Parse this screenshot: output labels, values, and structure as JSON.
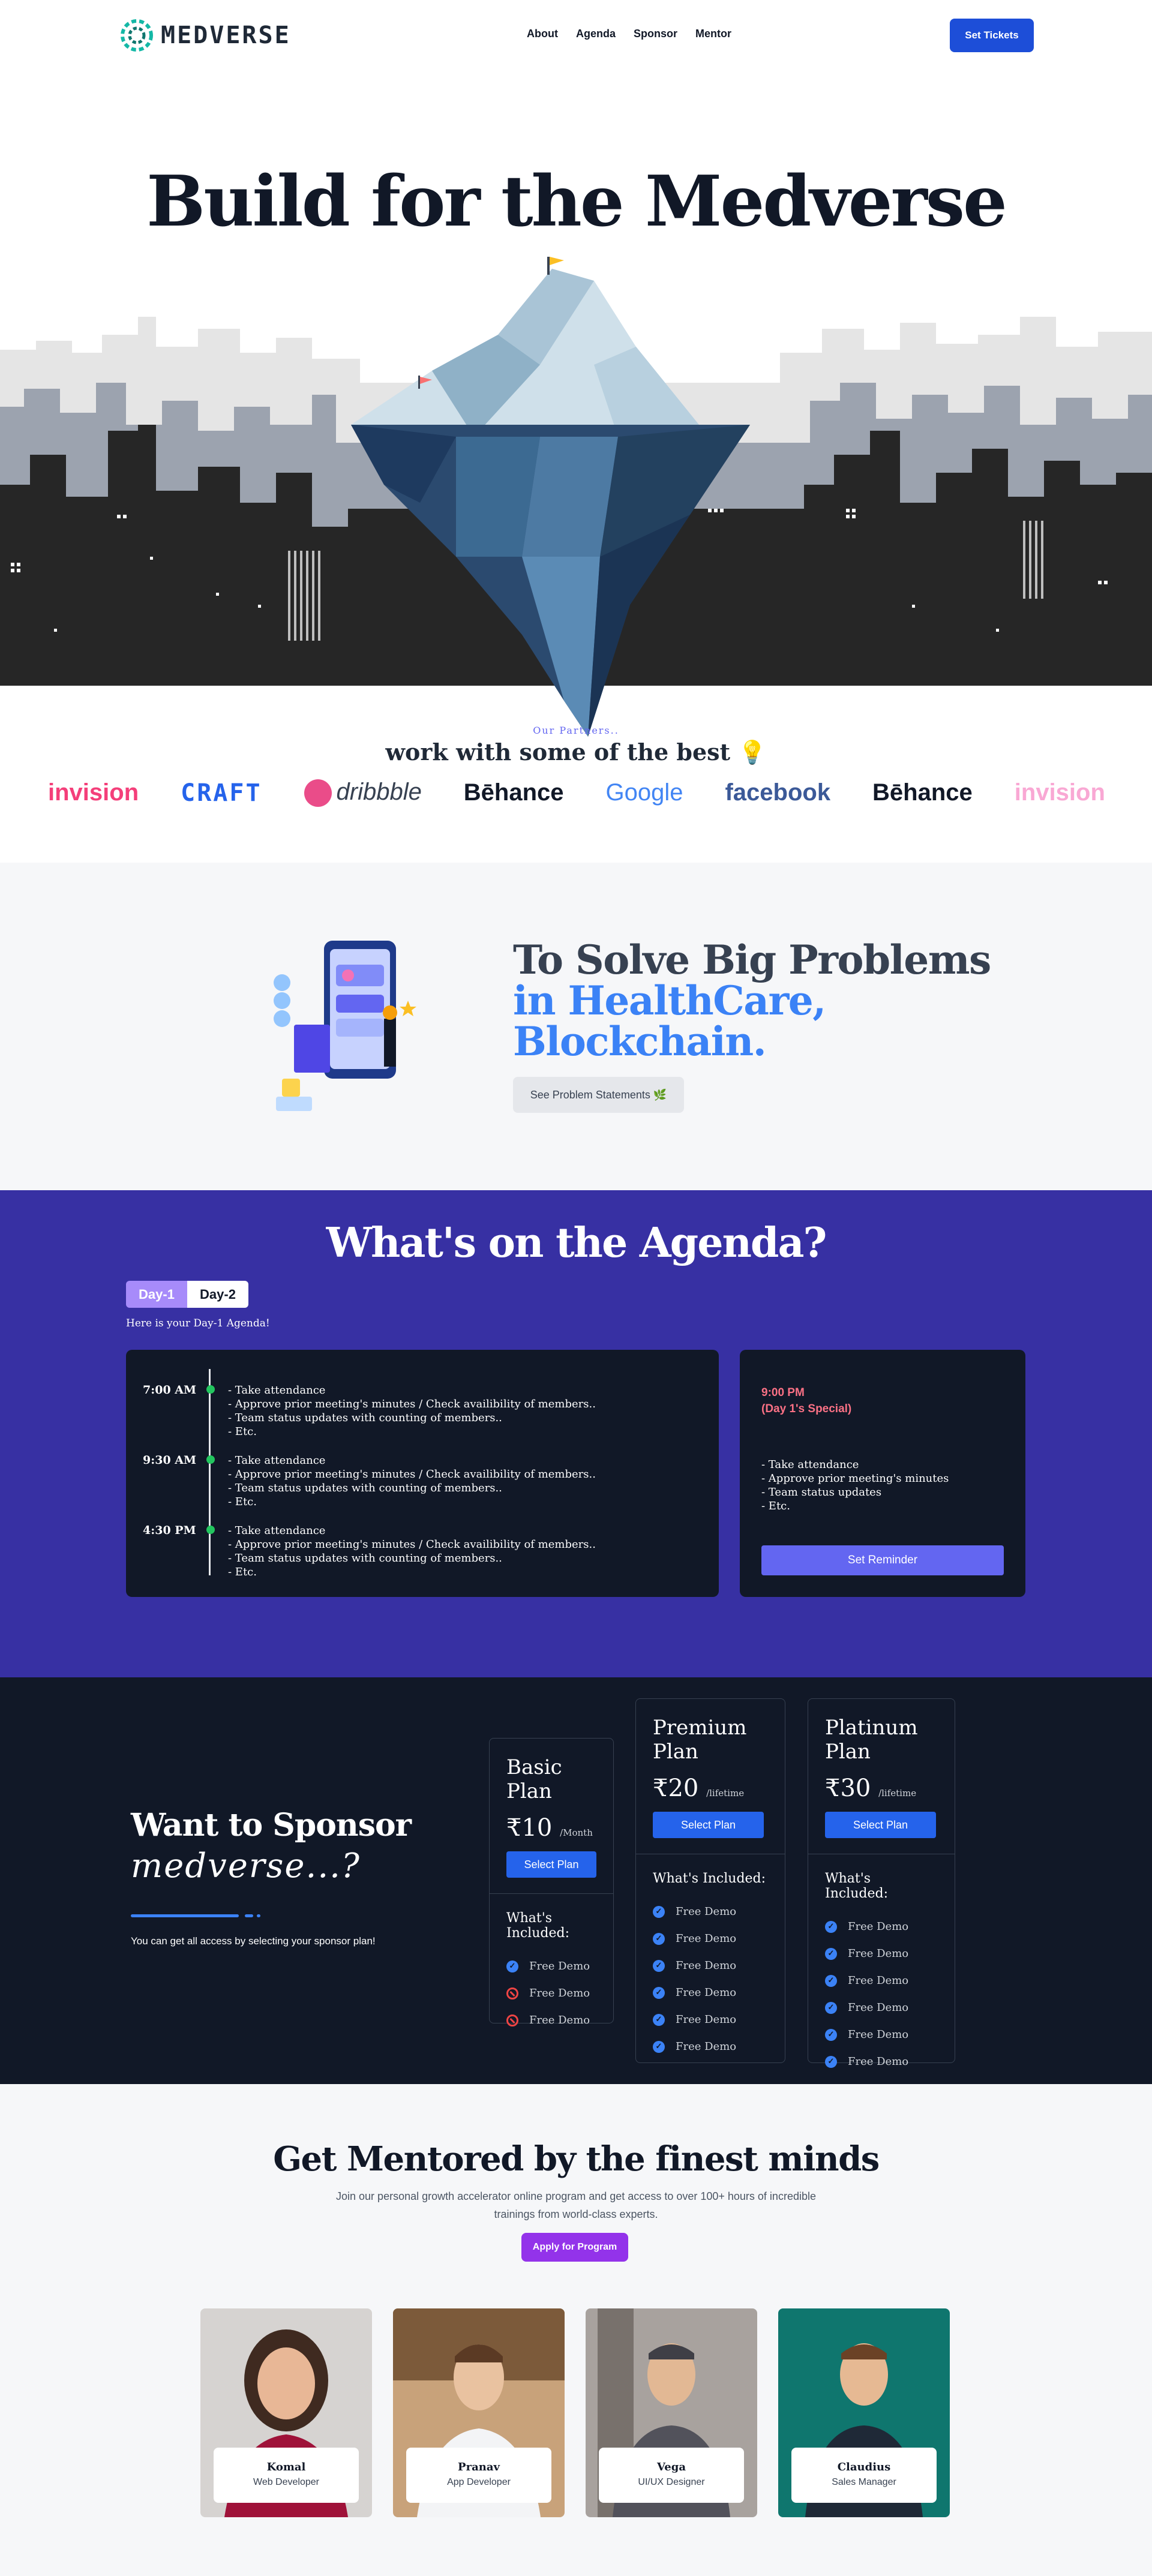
{
  "brand": {
    "name": "MEDVERSE"
  },
  "nav": {
    "links": [
      "About",
      "Agenda",
      "Sponsor",
      "Mentor"
    ],
    "cta": "Set Tickets"
  },
  "hero": {
    "title": "Build for the Medverse"
  },
  "partners": {
    "eyebrow": "Our Partners..",
    "title": "work with some of the best 💡",
    "logos": [
      "invision",
      "CRAFT",
      "dribbble",
      "Bēhance",
      "Google",
      "facebook",
      "Bēhance",
      "invision"
    ]
  },
  "problems": {
    "line1": "To Solve Big Problems",
    "line2": "in HealthCare,",
    "line3": "Blockchain.",
    "button": "See Problem Statements 🌿"
  },
  "agenda": {
    "title": "What's on the Agenda?",
    "tabs": [
      "Day-1",
      "Day-2"
    ],
    "subtitle": "Here is your Day-1 Agenda!",
    "slots": [
      {
        "time": "7:00 AM",
        "items": [
          "- Take attendance",
          "- Approve prior meeting's minutes / Check availibility of members..",
          "- Team status updates with counting of members..",
          "- Etc."
        ]
      },
      {
        "time": "9:30 AM",
        "items": [
          "- Take attendance",
          "- Approve prior meeting's minutes / Check availibility of members..",
          "- Team status updates with counting of members..",
          "- Etc."
        ]
      },
      {
        "time": "4:30 PM",
        "items": [
          "- Take attendance",
          "- Approve prior meeting's minutes / Check availibility of members..",
          "- Team status updates with counting of members..",
          "- Etc."
        ]
      }
    ],
    "special": {
      "time": "9:00 PM",
      "label": "(Day 1's Special)",
      "items": [
        "- Take attendance",
        "- Approve prior meeting's minutes",
        "- Team status updates",
        "- Etc."
      ],
      "button": "Set Reminder"
    }
  },
  "sponsor": {
    "title": "Want to Sponsor",
    "script": "medverse...?",
    "description": "You can get all access by selecting your sponsor plan!",
    "plans": [
      {
        "name": "Basic Plan",
        "price": "₹10",
        "period": "/Month",
        "button": "Select Plan",
        "included": "What's Included:",
        "features": [
          {
            "text": "Free Demo",
            "ok": true
          },
          {
            "text": "Free Demo",
            "ok": false
          },
          {
            "text": "Free Demo",
            "ok": false
          }
        ]
      },
      {
        "name": "Premium Plan",
        "price": "₹20",
        "period": "/lifetime",
        "button": "Select Plan",
        "included": "What's Included:",
        "features": [
          {
            "text": "Free Demo",
            "ok": true
          },
          {
            "text": "Free Demo",
            "ok": true
          },
          {
            "text": "Free Demo",
            "ok": true
          },
          {
            "text": "Free Demo",
            "ok": true
          },
          {
            "text": "Free Demo",
            "ok": true
          },
          {
            "text": "Free Demo",
            "ok": true
          }
        ]
      },
      {
        "name": "Platinum Plan",
        "price": "₹30",
        "period": "/lifetime",
        "button": "Select Plan",
        "included": "What's Included:",
        "features": [
          {
            "text": "Free Demo",
            "ok": true
          },
          {
            "text": "Free Demo",
            "ok": true
          },
          {
            "text": "Free Demo",
            "ok": true
          },
          {
            "text": "Free Demo",
            "ok": true
          },
          {
            "text": "Free Demo",
            "ok": true
          },
          {
            "text": "Free Demo",
            "ok": true
          }
        ]
      }
    ]
  },
  "mentors": {
    "title": "Get Mentored by the finest minds",
    "description": "Join our personal growth accelerator online program and get access to over 100+ hours of incredible trainings from world-class experts.",
    "button": "Apply for Program",
    "people": [
      {
        "name": "Komal",
        "role": "Web Developer"
      },
      {
        "name": "Pranav",
        "role": "App Developer"
      },
      {
        "name": "Vega",
        "role": "UI/UX Designer"
      },
      {
        "name": "Claudius",
        "role": "Sales Manager"
      }
    ]
  }
}
